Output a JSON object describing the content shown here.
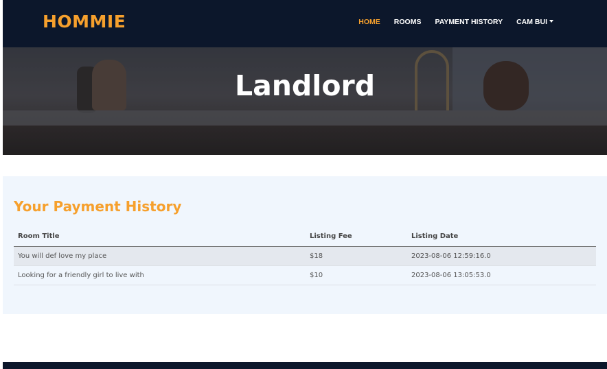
{
  "brand": "HOMMIE",
  "nav": {
    "home": "HOME",
    "rooms": "ROOMS",
    "payment_history": "PAYMENT HISTORY",
    "user": "CAM BUI"
  },
  "hero": {
    "title": "Landlord"
  },
  "payments": {
    "title": "Your Payment History",
    "columns": [
      "Room Title",
      "Listing Fee",
      "Listing Date"
    ],
    "rows": [
      [
        "You will def love my place",
        "$18",
        "2023-08-06 12:59:16.0"
      ],
      [
        "Looking for a friendly girl to live with",
        "$10",
        "2023-08-06 13:05:53.0"
      ]
    ]
  },
  "colors": {
    "accent": "#f6a02d",
    "navbar": "#0c172b",
    "section_bg": "#f0f6fd"
  }
}
